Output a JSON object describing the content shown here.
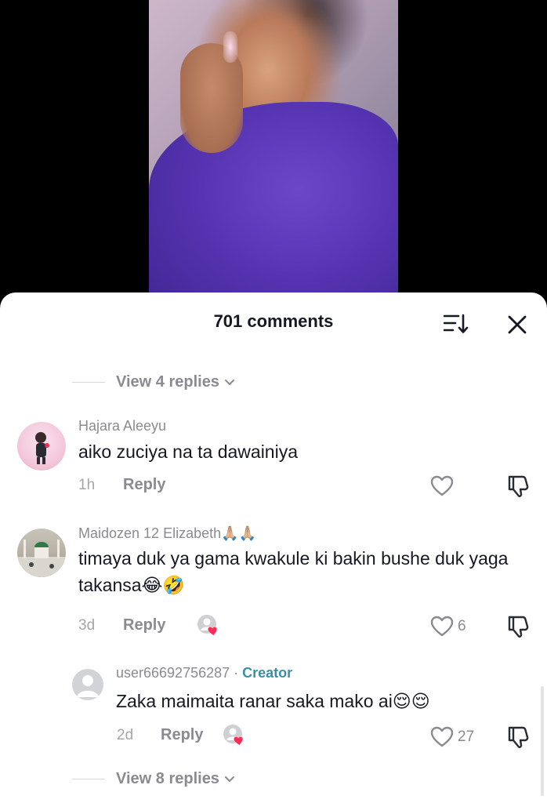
{
  "header": {
    "title": "701 comments"
  },
  "view_replies_top": {
    "label": "View 4 replies"
  },
  "comments": [
    {
      "username": "Hajara Aleeyu",
      "text": "aiko zuciya na ta dawainiya",
      "time": "1h",
      "reply_label": "Reply",
      "likes": ""
    },
    {
      "username": "Maidozen 12 Elizabeth🙏🏼🙏🏼",
      "text": "timaya duk ya gama kwakule ki bakin bushe duk yaga takansa😂🤣",
      "time": "3d",
      "reply_label": "Reply",
      "likes": "6"
    }
  ],
  "reply": {
    "username": "user66692756287",
    "separator": " · ",
    "creator_label": "Creator",
    "text": "Zaka maimaita ranar saka mako ai😌😌",
    "time": "2d",
    "reply_label": "Reply",
    "likes": "27"
  },
  "view_replies_bottom": {
    "label": "View 8 replies"
  },
  "colors": {
    "creator": "#3a8fa6",
    "heart_badge": "#fe2c55",
    "muted_text": "#8a8b91"
  },
  "icons": [
    "sort-icon",
    "close-icon",
    "heart-icon",
    "dislike-icon",
    "chevron-down-icon"
  ]
}
